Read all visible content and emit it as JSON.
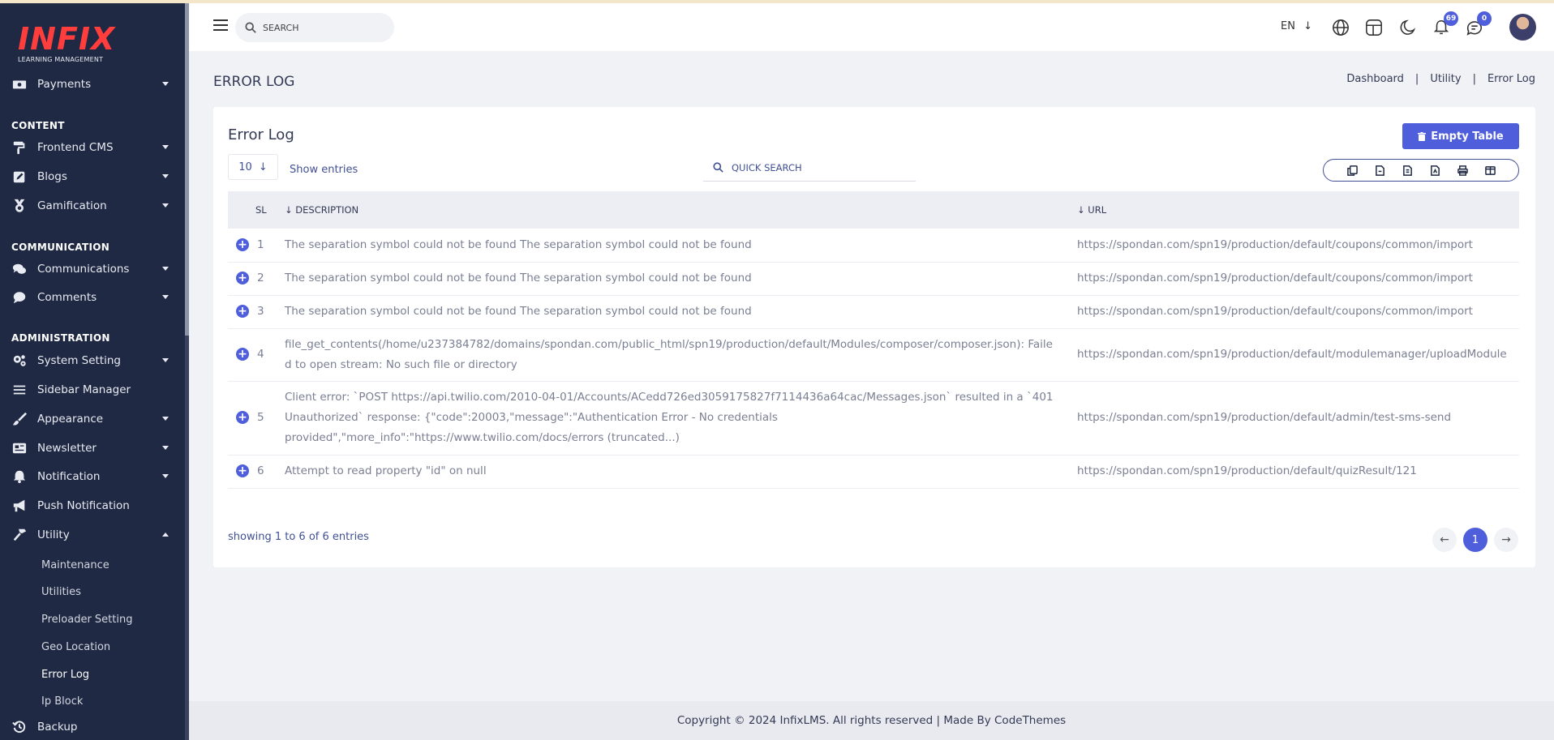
{
  "brand": {
    "logo_text": "INFIX",
    "tagline": "LEARNING MANAGEMENT"
  },
  "sidebar": {
    "payments": "Payments",
    "content_head": "CONTENT",
    "frontend_cms": "Frontend CMS",
    "blogs": "Blogs",
    "gamification": "Gamification",
    "communication_head": "COMMUNICATION",
    "communications": "Communications",
    "comments": "Comments",
    "administration_head": "ADMINISTRATION",
    "system_setting": "System Setting",
    "sidebar_manager": "Sidebar Manager",
    "appearance": "Appearance",
    "newsletter": "Newsletter",
    "notification": "Notification",
    "push_notification": "Push Notification",
    "utility": "Utility",
    "utility_sub": {
      "maintenance": "Maintenance",
      "utilities": "Utilities",
      "preloader": "Preloader Setting",
      "geo": "Geo Location",
      "error_log": "Error Log",
      "ip_block": "Ip Block"
    },
    "backup": "Backup"
  },
  "header": {
    "search_placeholder": "SEARCH",
    "lang": "EN",
    "notification_count": "69",
    "message_count": "0"
  },
  "page": {
    "title": "ERROR LOG",
    "breadcrumb": [
      "Dashboard",
      "Utility",
      "Error Log"
    ]
  },
  "card": {
    "title": "Error Log",
    "empty_button": "Empty Table",
    "entries_value": "10",
    "show_entries": "Show entries",
    "quick_search_placeholder": "QUICK SEARCH",
    "columns": {
      "sl": "SL",
      "description": "DESCRIPTION",
      "url": "URL"
    },
    "rows": [
      {
        "sl": "1",
        "description": "The separation symbol could not be found The separation symbol could not be found",
        "url": "https://spondan.com/spn19/production/default/coupons/common/import"
      },
      {
        "sl": "2",
        "description": "The separation symbol could not be found The separation symbol could not be found",
        "url": "https://spondan.com/spn19/production/default/coupons/common/import"
      },
      {
        "sl": "3",
        "description": "The separation symbol could not be found The separation symbol could not be found",
        "url": "https://spondan.com/spn19/production/default/coupons/common/import"
      },
      {
        "sl": "4",
        "description": "file_get_contents(/home/u237384782/domains/spondan.com/public_html/spn19/production/default/Modules/composer/composer.json): Failed to open stream: No such file or directory",
        "url": "https://spondan.com/spn19/production/default/modulemanager/uploadModule"
      },
      {
        "sl": "5",
        "description": "Client error: `POST https://api.twilio.com/2010-04-01/Accounts/ACedd726ed3059175827f7114436a64cac/Messages.json` resulted in a `401 Unauthorized` response: {\"code\":20003,\"message\":\"Authentication Error - No credentials provided\",\"more_info\":\"https://www.twilio.com/docs/errors (truncated...)",
        "url": "https://spondan.com/spn19/production/default/admin/test-sms-send"
      },
      {
        "sl": "6",
        "description": "Attempt to read property \"id\" on null",
        "url": "https://spondan.com/spn19/production/default/quizResult/121"
      }
    ],
    "showing": "showing 1 to 6 of 6 entries",
    "current_page": "1"
  },
  "footer": {
    "text": "Copyright © 2024 InfixLMS. All rights reserved | Made By CodeThemes"
  },
  "colors": {
    "accent": "#4f5fdb",
    "sidebar_bg": "#1f2943",
    "logo_red": "#ff3d3d"
  }
}
